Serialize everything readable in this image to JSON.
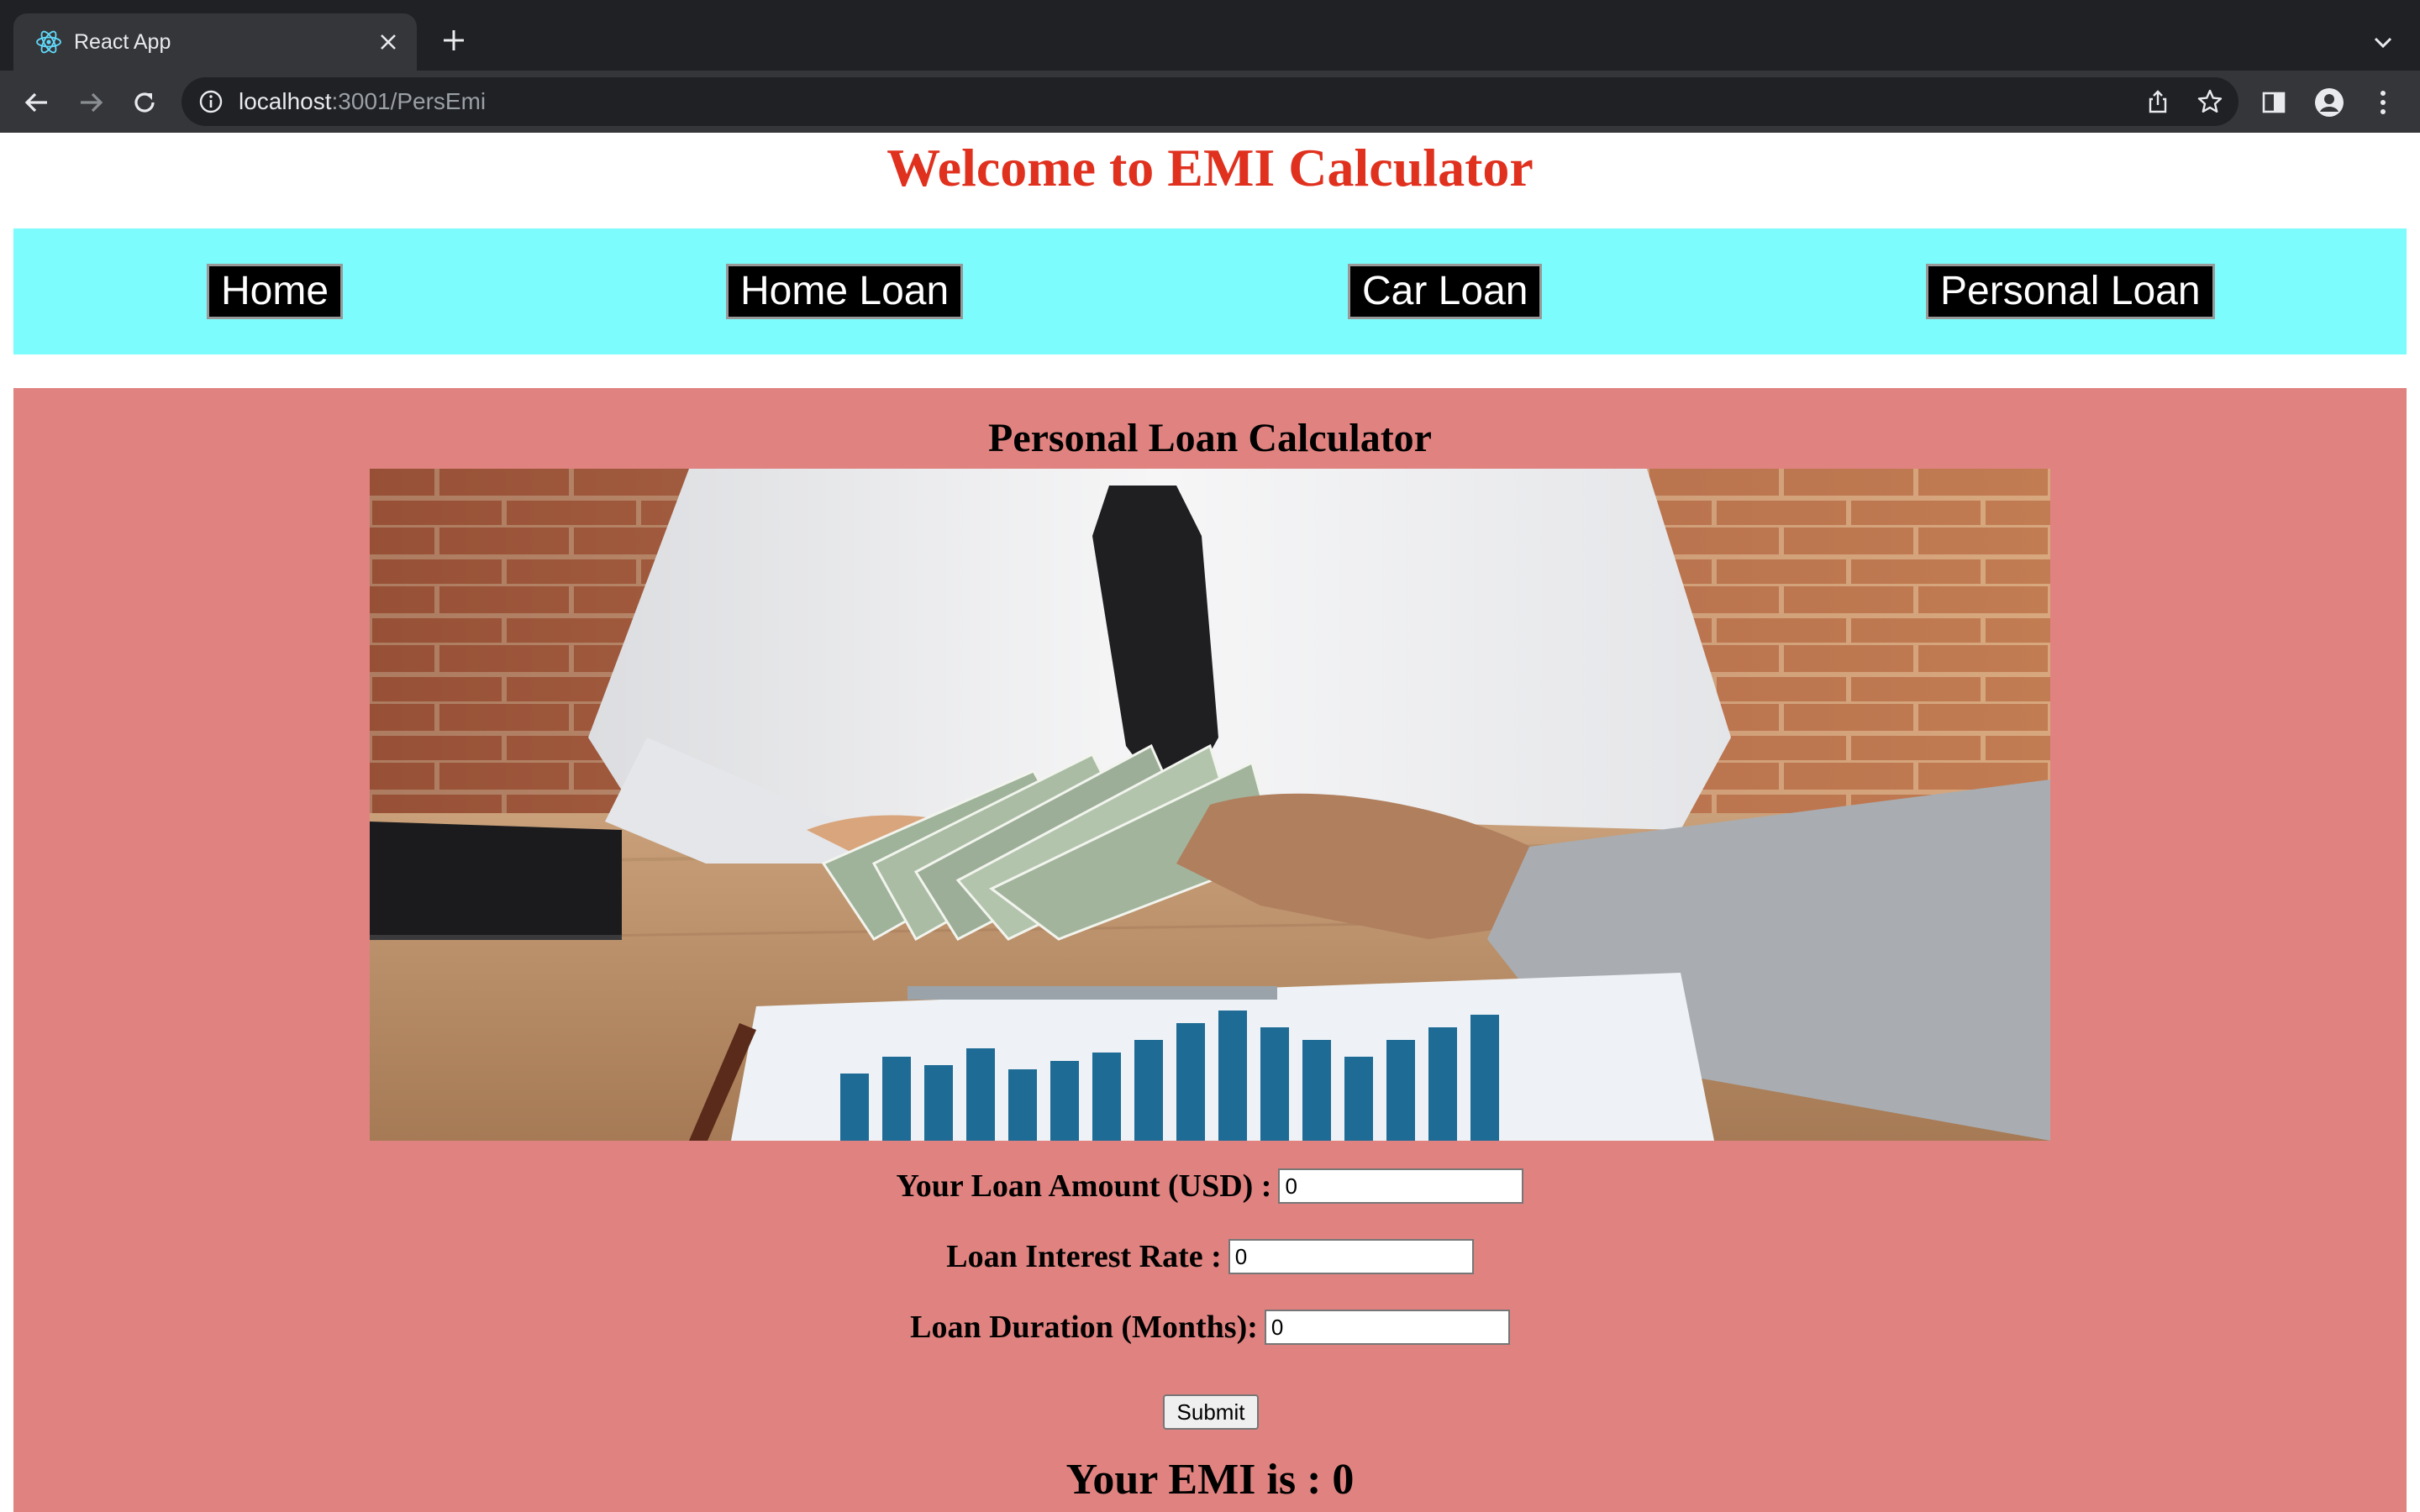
{
  "browser": {
    "tab_title": "React App",
    "url_host": "localhost",
    "url_rest": ":3001/PersEmi",
    "icons": [
      "react-favicon",
      "close-icon",
      "plus-icon",
      "chevron-down-icon",
      "back-arrow-icon",
      "forward-arrow-icon",
      "reload-icon",
      "info-icon",
      "share-icon",
      "star-icon",
      "sidebar-icon",
      "profile-icon",
      "kebab-menu-icon"
    ]
  },
  "page": {
    "title": "Welcome to EMI Calculator",
    "title_color": "#e0301e"
  },
  "nav": {
    "background": "#7cfcfc",
    "links": [
      "Home",
      "Home Loan",
      "Car Loan",
      "Personal Loan"
    ]
  },
  "calculator": {
    "background": "#e08380",
    "title": "Personal Loan Calculator",
    "fields": [
      {
        "label": "Your Loan Amount (USD) :",
        "value": "0"
      },
      {
        "label": "Loan Interest Rate :",
        "value": "0"
      },
      {
        "label": "Loan Duration (Months):",
        "value": "0"
      }
    ],
    "submit_label": "Submit",
    "result": "Your EMI is : 0"
  }
}
